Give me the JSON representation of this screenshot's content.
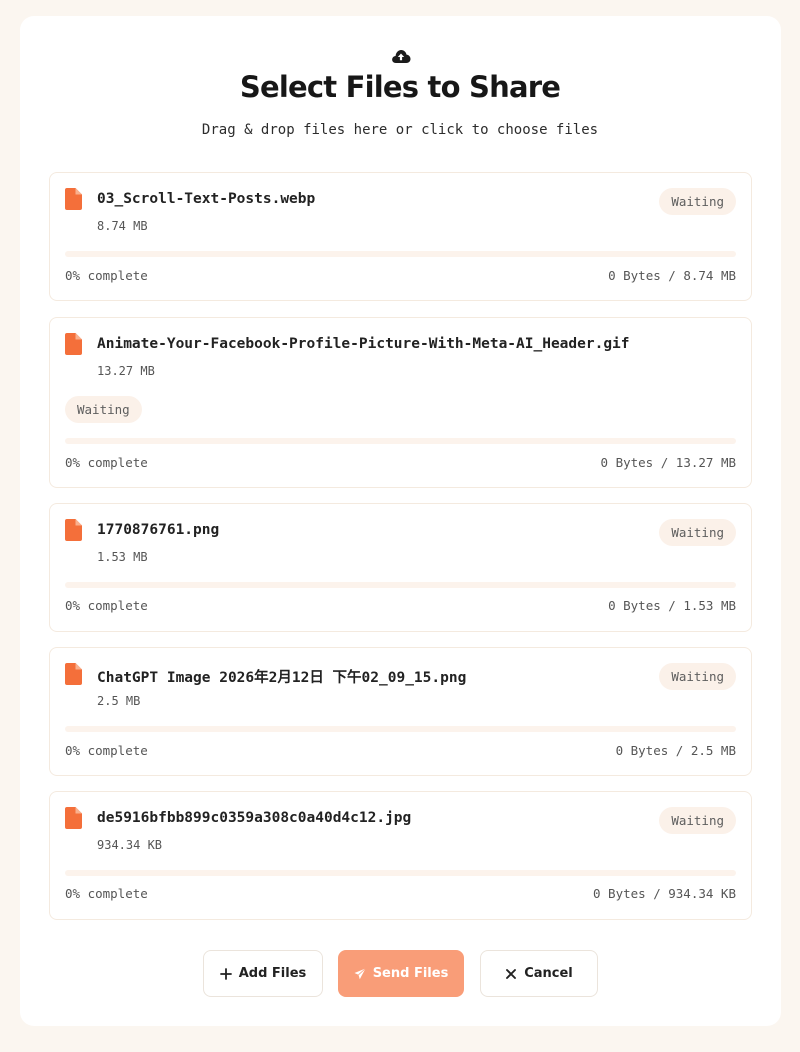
{
  "header": {
    "icon": "cloud-upload-icon",
    "title": "Select Files to Share",
    "subtitle": "Drag & drop files here or click to choose files"
  },
  "colors": {
    "accent": "#f58b5a",
    "file_icon": "#f46f3a",
    "badge_bg": "#fbf1e9",
    "progress_track": "#fcf3ec"
  },
  "files": [
    {
      "name": "03_Scroll-Text-Posts.webp",
      "size": "8.74 MB",
      "status": "Waiting",
      "progress_percent": 0,
      "progress_label": "0% complete",
      "bytes": "0 Bytes / 8.74 MB"
    },
    {
      "name": "Animate-Your-Facebook-Profile-Picture-With-Meta-AI_Header.gif",
      "size": "13.27 MB",
      "status": "Waiting",
      "progress_percent": 0,
      "progress_label": "0% complete",
      "bytes": "0 Bytes / 13.27 MB"
    },
    {
      "name": "1770876761.png",
      "size": "1.53 MB",
      "status": "Waiting",
      "progress_percent": 0,
      "progress_label": "0% complete",
      "bytes": "0 Bytes / 1.53 MB"
    },
    {
      "name": "ChatGPT Image 2026年2月12日 下午02_09_15.png",
      "size": "2.5 MB",
      "status": "Waiting",
      "progress_percent": 0,
      "progress_label": "0% complete",
      "bytes": "0 Bytes / 2.5 MB"
    },
    {
      "name": "de5916bfbb899c0359a308c0a40d4c12.jpg",
      "size": "934.34 KB",
      "status": "Waiting",
      "progress_percent": 0,
      "progress_label": "0% complete",
      "bytes": "0 Bytes / 934.34 KB"
    }
  ],
  "actions": {
    "add_label": "Add Files",
    "add_icon": "plus-icon",
    "send_label": "Send Files",
    "send_icon": "paper-plane-icon",
    "cancel_label": "Cancel",
    "cancel_icon": "close-icon"
  }
}
